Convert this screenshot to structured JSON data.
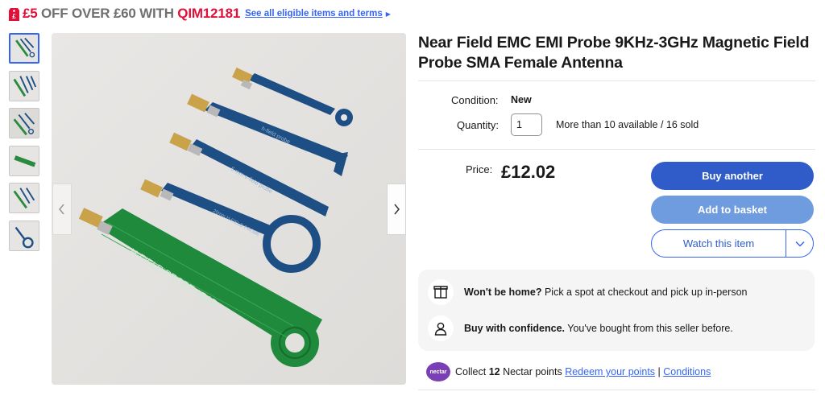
{
  "promo": {
    "amount": "£5",
    "middle": " OFF OVER £60 WITH ",
    "code": "QIM12181",
    "link": "See all eligible items and terms",
    "icon": "price-tag-icon"
  },
  "gallery": {
    "thumbnails": [
      "probe-set-photo",
      "probe-set-photo",
      "probe-set-photo",
      "probe-single-photo",
      "probe-set-photo",
      "probe-loop-photo"
    ],
    "prev_icon": "chevron-left-icon",
    "next_icon": "chevron-right-icon",
    "pcb_print": {
      "large_probe": "H-FIELD PROBE #R15",
      "mid_probe": "5 mm e-field probe",
      "h_probe": "h-field probe",
      "loop_probe": "20mm H-FIELD PROBE"
    }
  },
  "title": "Near Field EMC EMI Probe 9KHz-3GHz Magnetic Field Probe SMA Female Antenna",
  "condition": {
    "label": "Condition:",
    "value": "New"
  },
  "quantity": {
    "label": "Quantity:",
    "value": "1",
    "availability": "More than 10 available / 16 sold"
  },
  "price": {
    "label": "Price:",
    "value": "£12.02"
  },
  "actions": {
    "buy": "Buy another",
    "basket": "Add to basket",
    "watch": "Watch this item",
    "watch_dropdown_icon": "chevron-down-icon"
  },
  "info": [
    {
      "icon": "package-icon",
      "bold": "Won't be home?",
      "text": " Pick a spot at checkout and pick up in-person"
    },
    {
      "icon": "person-icon",
      "bold": "Buy with confidence.",
      "text": " You've bought from this seller before."
    }
  ],
  "nectar": {
    "logo": "nectar",
    "pre": "Collect ",
    "points": "12",
    "post": " Nectar points ",
    "redeem": "Redeem your points",
    "sep": " | ",
    "conditions": "Conditions"
  },
  "colors": {
    "accent": "#3665f3",
    "primary_button": "#2f5cc9",
    "basket_button": "#6f9cde",
    "promo_red": "#e0103a",
    "pcb_green": "#1f8a3c",
    "pcb_blue": "#1d4f84"
  }
}
